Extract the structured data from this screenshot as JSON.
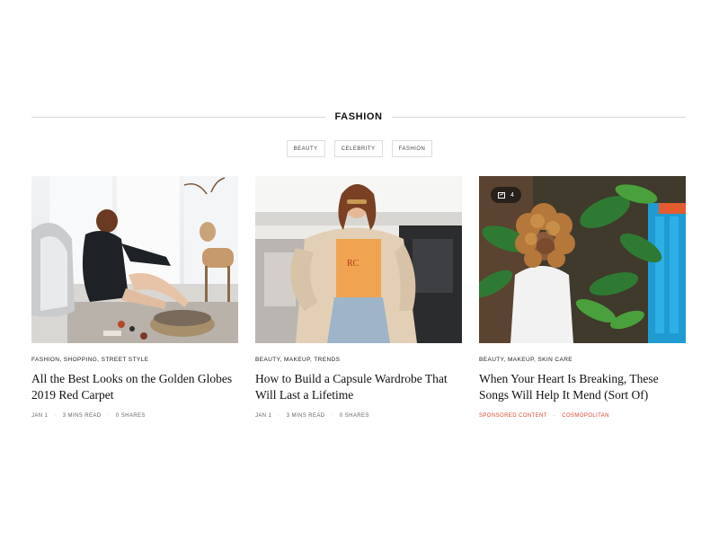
{
  "section": {
    "title": "FASHION"
  },
  "filters": [
    "BEAUTY",
    "CELEBRITY",
    "FASHION"
  ],
  "cards": [
    {
      "tags": "FASHION, SHOPPING, STREET STYLE",
      "headline": "All the Best Looks on the Golden Globes 2019 Red Carpet",
      "meta": [
        "JAN 1",
        "3 MINS READ",
        "0 SHARES"
      ],
      "image_alt": "woman-sitting-on-rug-photo"
    },
    {
      "tags": "BEAUTY, MAKEUP, TRENDS",
      "headline": "How to Build a Capsule Wardrobe That Will Last a Lifetime",
      "meta": [
        "JAN 1",
        "3 MINS READ",
        "0 SHARES"
      ],
      "image_alt": "woman-in-teddy-coat-photo"
    },
    {
      "tags": "BEAUTY, MAKEUP, SKIN CARE",
      "headline": "When Your Heart Is Breaking, These Songs Will Help It Mend (Sort Of)",
      "meta": [
        "SPONSORED CONTENT",
        "COSMOPOLITAN"
      ],
      "gallery_count": "4",
      "image_alt": "woman-with-curly-hair-plants-photo"
    }
  ],
  "colors": {
    "sponsored": "#e0432a",
    "rule": "#d6d6d6"
  }
}
